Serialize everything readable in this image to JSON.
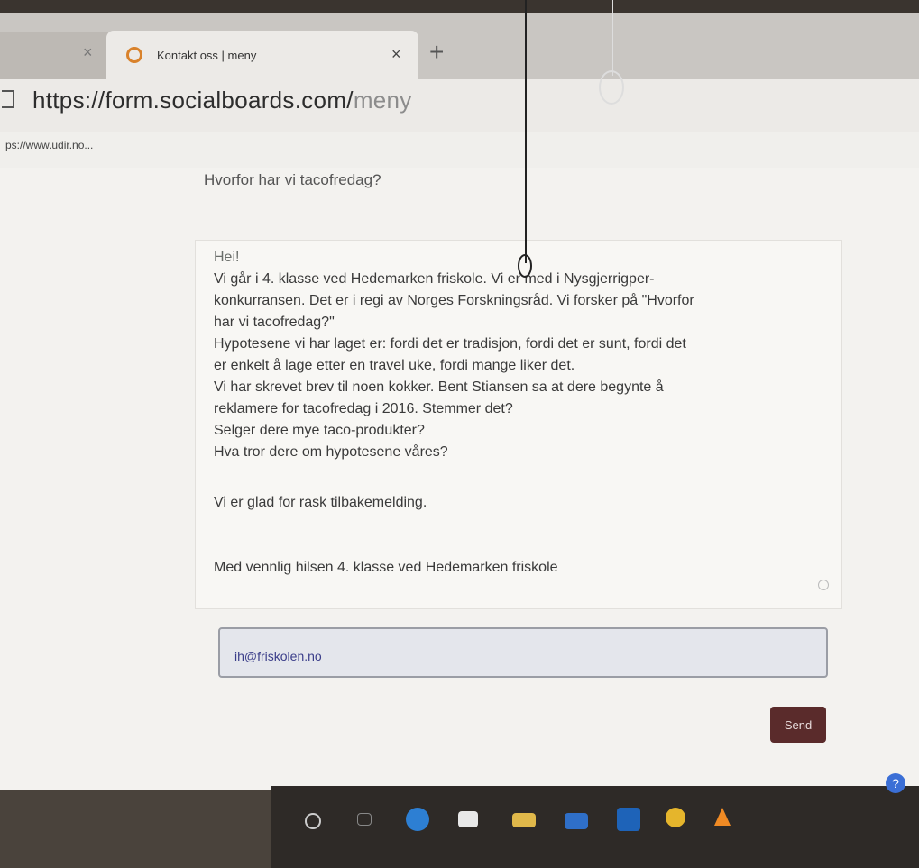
{
  "browser": {
    "tab_title": "Kontakt oss | meny",
    "tab_close": "×",
    "prev_tab_close": "×",
    "new_tab": "+",
    "address_main": "https://form.socialboards.com/",
    "address_path": "meny",
    "bookmark": "ps://www.udir.no..."
  },
  "page": {
    "header_fragment": "Hvorfor har vi tacofredag?",
    "message_lines": [
      "Hei!",
      "Vi går i 4. klasse ved Hedemarken friskole. Vi er med i Nysgjerrigper-",
      "konkurransen. Det er i regi av Norges Forskningsråd. Vi forsker på \"Hvorfor",
      "har vi tacofredag?\"",
      "Hypotesene vi har laget er: fordi det er tradisjon, fordi det er sunt, fordi det",
      "er enkelt å lage etter en travel uke, fordi mange liker det.",
      "Vi har skrevet brev til noen kokker. Bent Stiansen sa at dere begynte å",
      "reklamere for tacofredag i 2016. Stemmer det?",
      "Selger dere mye taco-produkter?",
      "Hva tror dere om hypotesene våres?",
      "",
      "Vi er glad for rask tilbakemelding.",
      "",
      "Med vennlig hilsen 4. klasse ved Hedemarken friskole"
    ],
    "email_value": "ih@friskolen.no",
    "send_label": "Send"
  },
  "taskbar": {
    "help_label": "?"
  },
  "colors": {
    "send_button": "#5a2b2b",
    "email_text": "#3b3e8a"
  }
}
